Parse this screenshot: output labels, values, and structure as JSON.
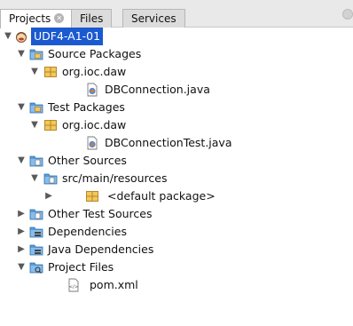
{
  "tabs": [
    {
      "label": "Projects",
      "active": true,
      "closable": true
    },
    {
      "label": "Files",
      "active": false
    },
    {
      "label": "Services",
      "active": false
    }
  ],
  "tree": {
    "project": {
      "label": "UDF4-A1-01",
      "icon": "maven-project-icon",
      "expanded": true,
      "selected": true
    },
    "source_packages": {
      "label": "Source Packages",
      "icon": "source-folder-icon",
      "expanded": true
    },
    "src_pkg": {
      "label": "org.ioc.daw",
      "icon": "package-icon",
      "expanded": true
    },
    "src_file": {
      "label": "DBConnection.java",
      "icon": "java-file-icon"
    },
    "test_packages": {
      "label": "Test Packages",
      "icon": "test-folder-icon",
      "expanded": true
    },
    "test_pkg": {
      "label": "org.ioc.daw",
      "icon": "package-icon",
      "expanded": true
    },
    "test_file": {
      "label": "DBConnectionTest.java",
      "icon": "java-file-icon"
    },
    "other_sources": {
      "label": "Other Sources",
      "icon": "folder-icon",
      "expanded": true
    },
    "resources": {
      "label": "src/main/resources",
      "icon": "folder-icon",
      "expanded": true
    },
    "default_pkg": {
      "label": "<default package>",
      "icon": "package-icon",
      "expanded": false
    },
    "other_test_sources": {
      "label": "Other Test Sources",
      "icon": "folder-icon",
      "expanded": false
    },
    "dependencies": {
      "label": "Dependencies",
      "icon": "library-folder-icon",
      "expanded": false
    },
    "java_dependencies": {
      "label": "Java Dependencies",
      "icon": "library-folder-icon",
      "expanded": false
    },
    "project_files": {
      "label": "Project Files",
      "icon": "project-files-folder-icon",
      "expanded": true
    },
    "pom": {
      "label": "pom.xml",
      "icon": "xml-file-icon"
    }
  },
  "colors": {
    "selection": "#1b59d0",
    "folder_blue": "#5b9bd5",
    "package_yellow": "#e8b84a"
  }
}
